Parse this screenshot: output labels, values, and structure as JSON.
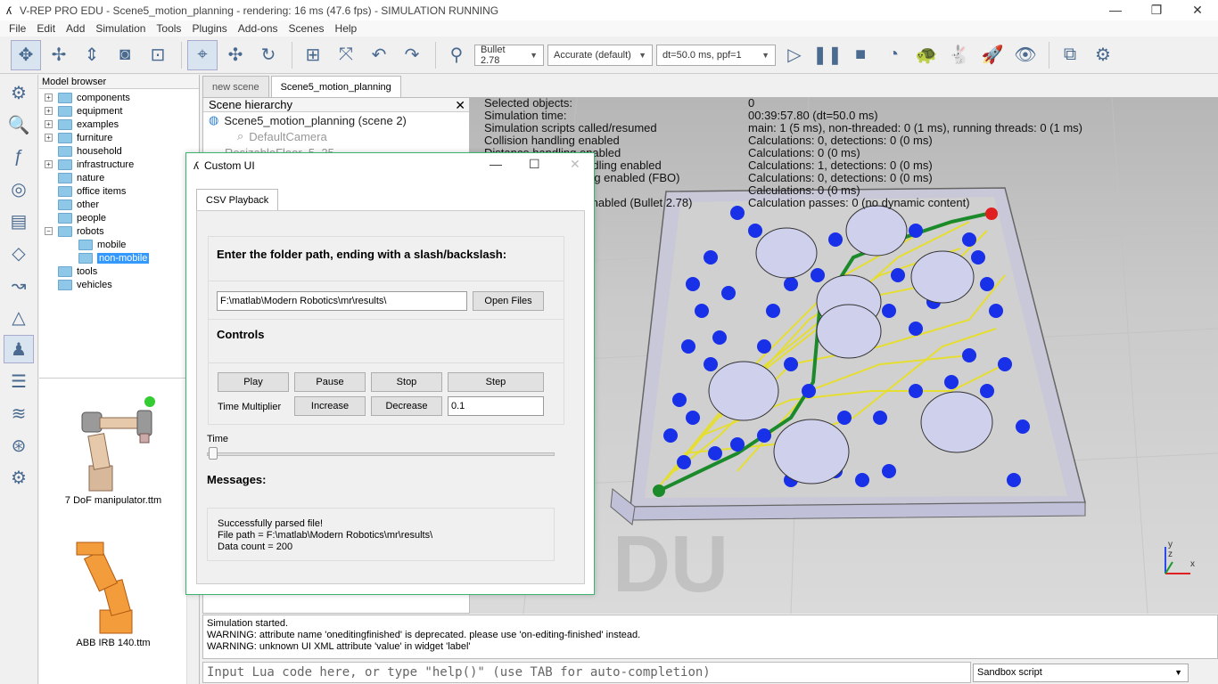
{
  "window": {
    "title": "V-REP PRO EDU - Scene5_motion_planning - rendering: 16 ms (47.6 fps) - SIMULATION RUNNING",
    "minimize": "—",
    "maximize": "❐",
    "close": "✕"
  },
  "menu": [
    "File",
    "Edit",
    "Add",
    "Simulation",
    "Tools",
    "Plugins",
    "Add-ons",
    "Scenes",
    "Help"
  ],
  "toolbar": {
    "engine": "Bullet 2.78",
    "accuracy": "Accurate (default)",
    "dt": "dt=50.0 ms, ppf=1"
  },
  "model_browser": {
    "title": "Model browser",
    "items": [
      "components",
      "equipment",
      "examples",
      "furniture",
      "household",
      "infrastructure",
      "nature",
      "office items",
      "other",
      "people",
      "robots",
      "mobile",
      "non-mobile",
      "tools",
      "vehicles"
    ],
    "thumbs": [
      "7 DoF manipulator.ttm",
      "ABB IRB 140.ttm"
    ]
  },
  "tabs": [
    "new scene",
    "Scene5_motion_planning"
  ],
  "scene_hierarchy": {
    "title": "Scene hierarchy",
    "close": "✕",
    "root": "Scene5_motion_planning (scene 2)",
    "child1": "DefaultCamera",
    "child2": "ResizableFloor_5_25"
  },
  "info_left": "Selected objects:\nSimulation time:\nSimulation scripts called/resumed\nCollision handling enabled\nDistance handling enabled\nProximity sensor handling enabled\nVision sensor handling enabled (FBO)\nIK handling enabled\nDynamics handling enabled (Bullet 2.78)",
  "info_right": "0\n00:39:57.80 (dt=50.0 ms)\nmain: 1 (5 ms), non-threaded: 0 (1 ms), running threads: 0 (1 ms)\nCalculations: 0, detections: 0 (0 ms)\nCalculations: 0 (0 ms)\nCalculations: 1, detections: 0 (0 ms)\nCalculations: 0, detections: 0 (0 ms)\nCalculations: 0 (0 ms)\nCalculation passes: 0 (no dynamic content)",
  "axes": {
    "y": "y",
    "z": "z",
    "x": "x"
  },
  "custom_ui": {
    "title": "Custom UI",
    "min": "—",
    "max": "☐",
    "close": "✕",
    "tab": "CSV Playback",
    "folder_heading": "Enter the folder path, ending with a slash/backslash:",
    "folder_value": "F:\\matlab\\Modern Robotics\\mr\\results\\",
    "open_files": "Open Files",
    "controls_heading": "Controls",
    "play": "Play",
    "pause": "Pause",
    "stop": "Stop",
    "step": "Step",
    "time_multiplier_label": "Time Multiplier",
    "increase": "Increase",
    "decrease": "Decrease",
    "multiplier_value": "0.1",
    "time_label": "Time",
    "time_position": 0,
    "messages_heading": "Messages:",
    "msg1": "Successfully parsed file!",
    "msg2": "File path = F:\\matlab\\Modern Robotics\\mr\\results\\",
    "msg3": "Data count = 200"
  },
  "console": [
    "Simulation started.",
    "WARNING: attribute name 'oneditingfinished' is deprecated. please use 'on-editing-finished' instead.",
    "WARNING: unknown UI XML attribute 'value' in widget 'label'"
  ],
  "lua_placeholder": "Input Lua code here, or type \"help()\" (use TAB for auto-completion)",
  "sandbox": "Sandbox script"
}
